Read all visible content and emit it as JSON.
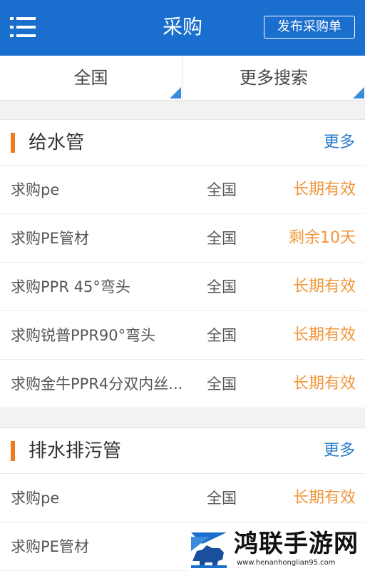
{
  "header": {
    "title": "采购",
    "publish_label": "发布采购单"
  },
  "filters": {
    "region": "全国",
    "more": "更多搜索"
  },
  "sections": [
    {
      "title": "给水管",
      "more": "更多",
      "items": [
        {
          "title": "求购pe",
          "region": "全国",
          "status": "长期有效"
        },
        {
          "title": "求购PE管材",
          "region": "全国",
          "status": "剩余10天"
        },
        {
          "title": "求购PPR 45°弯头",
          "region": "全国",
          "status": "长期有效"
        },
        {
          "title": "求购锐普PPR90°弯头",
          "region": "全国",
          "status": "长期有效"
        },
        {
          "title": "求购金牛PPR4分双内丝...",
          "region": "全国",
          "status": "长期有效"
        }
      ]
    },
    {
      "title": "排水排污管",
      "more": "更多",
      "items": [
        {
          "title": "求购pe",
          "region": "全国",
          "status": "长期有效"
        },
        {
          "title": "求购PE管材",
          "region": "",
          "status": ""
        }
      ]
    }
  ],
  "watermark": {
    "name": "鸿联手游网",
    "url": "www.henanhonglian95.com"
  },
  "colors": {
    "header_bg": "#1a6fce",
    "accent_orange": "#f07a1e",
    "status_orange": "#f3963a",
    "link_blue": "#2a7bc9"
  }
}
